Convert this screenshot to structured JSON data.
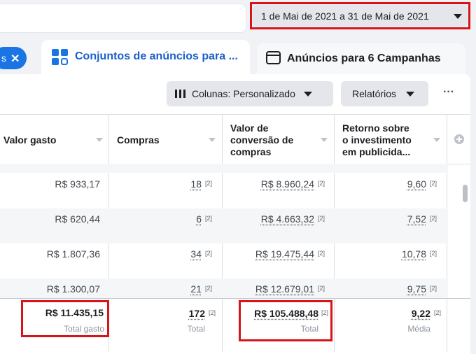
{
  "date_range": {
    "label": "1 de Mai de 2021 a 31 de Mai de 2021"
  },
  "tabs": {
    "chip_label": "s",
    "active_label": "Conjuntos de anúncios para ...",
    "inactive_label": "Anúncios para 6 Campanhas"
  },
  "toolbar": {
    "columns_label": "Colunas: Personalizado",
    "reports_label": "Relatórios",
    "more_label": "···"
  },
  "table": {
    "headers": {
      "spent": "Valor gasto",
      "purchases": "Compras",
      "conv_value_1": "Valor de",
      "conv_value_2": "conversão de",
      "conv_value_3": "compras",
      "roas_1": "Retorno sobre",
      "roas_2": "o investimento",
      "roas_3": "em publicida..."
    },
    "footnote": "[2]",
    "rows": [
      {
        "spent": "R$ 933,17",
        "purchases": "18",
        "conv_value": "R$ 8.960,24",
        "roas": "9,60"
      },
      {
        "spent": "R$ 620,44",
        "purchases": "6",
        "conv_value": "R$ 4.663,32",
        "roas": "7,52"
      },
      {
        "spent": "R$ 1.807,36",
        "purchases": "34",
        "conv_value": "R$ 19.475,44",
        "roas": "10,78"
      },
      {
        "spent": "R$ 1.300,07",
        "purchases": "21",
        "conv_value": "R$ 12.679,01",
        "roas": "9,75"
      }
    ],
    "totals": {
      "spent": "R$ 11.435,15",
      "spent_label": "Total gasto",
      "purchases": "172",
      "purchases_label": "Total",
      "conv_value": "R$ 105.488,48",
      "conv_value_label": "Total",
      "roas": "9,22",
      "roas_label": "Média"
    }
  },
  "colors": {
    "accent": "#1b74e4",
    "highlight": "#d7141a"
  }
}
